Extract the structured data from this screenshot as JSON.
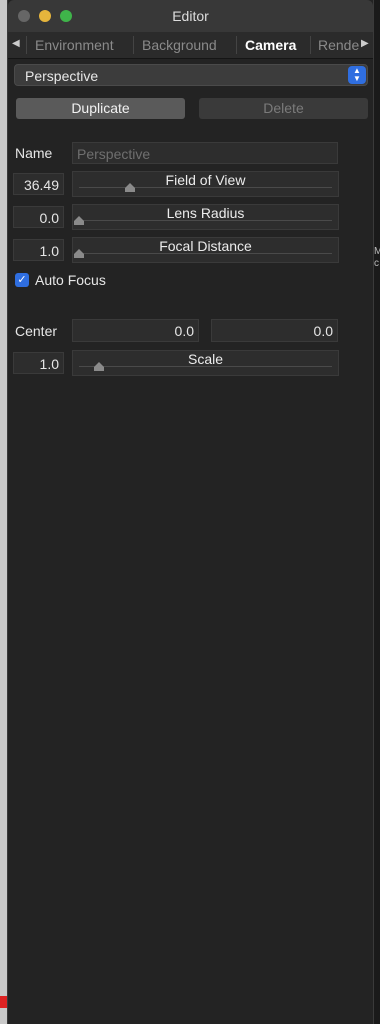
{
  "window": {
    "title": "Editor"
  },
  "tabs": [
    {
      "label": "Environment",
      "active": false
    },
    {
      "label": "Background",
      "active": false
    },
    {
      "label": "Camera",
      "active": true
    },
    {
      "label": "Rende",
      "active": false
    }
  ],
  "preset": {
    "value": "Perspective"
  },
  "buttons": {
    "duplicate": "Duplicate",
    "delete": "Delete"
  },
  "name_row": {
    "label": "Name",
    "placeholder": "Perspective"
  },
  "sliders": [
    {
      "value": "36.49",
      "label": "Field of View",
      "level": 0.2
    },
    {
      "value": "0.0",
      "label": "Lens Radius",
      "level": 0.0
    },
    {
      "value": "1.0",
      "label": "Focal Distance",
      "level": 0.0
    }
  ],
  "auto_focus": {
    "label": "Auto Focus",
    "checked": true
  },
  "center": {
    "label": "Center",
    "x": "0.0",
    "y": "0.0"
  },
  "scale": {
    "value": "1.0",
    "label": "Scale",
    "level": 0.08
  },
  "colors": {
    "accent": "#2f6ee0",
    "background": "#232323",
    "field": "#2d2d2d"
  }
}
